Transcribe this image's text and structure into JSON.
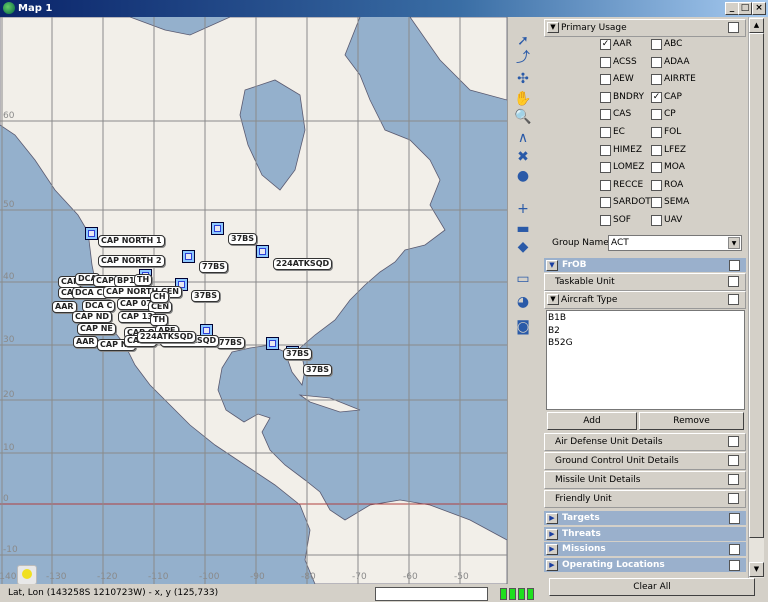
{
  "window": {
    "title": "Map 1",
    "controls": [
      "_",
      "□",
      "×"
    ]
  },
  "map": {
    "lat_labels": [
      "60",
      "50",
      "40",
      "30",
      "20",
      "10",
      "0",
      "-10"
    ],
    "lon_labels": [
      "-140",
      "-130",
      "-120",
      "-110",
      "-100",
      "-90",
      "-80",
      "-70",
      "-60",
      "-50"
    ],
    "colors": {
      "land": "#f2efe9",
      "water": "#94b0cc",
      "equator": "#b04040"
    },
    "labels": [
      "CAP NORTH 1",
      "CAP NORTH 2",
      "37BS",
      "224ATKSQD",
      "77BS",
      "37BS",
      "77BS",
      "37BS",
      "37BS",
      "224ATKSQD",
      "CAP",
      "DCA",
      "CAP G",
      "BP1",
      "TH",
      "CAP",
      "DCA CA",
      "CAP NORTH CEN",
      "AAR",
      "DCA C",
      "CAP 07",
      "CEN",
      "CAP ND",
      "CAP 13",
      "CH",
      "TH",
      "CAP NE",
      "CAP O",
      "APE",
      "AAR",
      "CAP NF",
      "CAP R",
      "224ATKSQD"
    ]
  },
  "toolbar": [
    "select-arrow",
    "select-route",
    "compass",
    "pan-hand",
    "zoom",
    "measure",
    "delete",
    "highlight",
    "add-point",
    "add-line",
    "add-area",
    "tag",
    "globe-back",
    "globe-lock"
  ],
  "panel": {
    "primary_usage": {
      "title": "Primary Usage",
      "checked": false,
      "items": [
        {
          "label": "AAR",
          "checked": true
        },
        {
          "label": "ABC",
          "checked": false
        },
        {
          "label": "ACSS",
          "checked": false
        },
        {
          "label": "ADAA",
          "checked": false
        },
        {
          "label": "AEW",
          "checked": false
        },
        {
          "label": "AIRRTE",
          "checked": false
        },
        {
          "label": "BNDRY",
          "checked": false
        },
        {
          "label": "CAP",
          "checked": true
        },
        {
          "label": "CAS",
          "checked": false
        },
        {
          "label": "CP",
          "checked": false
        },
        {
          "label": "EC",
          "checked": false
        },
        {
          "label": "FOL",
          "checked": false
        },
        {
          "label": "HIMEZ",
          "checked": false
        },
        {
          "label": "LFEZ",
          "checked": false
        },
        {
          "label": "LOMEZ",
          "checked": false
        },
        {
          "label": "MOA",
          "checked": false
        },
        {
          "label": "RECCE",
          "checked": false
        },
        {
          "label": "ROA",
          "checked": false
        },
        {
          "label": "SARDOT",
          "checked": false
        },
        {
          "label": "SEMA",
          "checked": false
        },
        {
          "label": "SOF",
          "checked": false
        },
        {
          "label": "UAV",
          "checked": false
        }
      ]
    },
    "group_name": {
      "label": "Group Name:",
      "value": "ACT"
    },
    "frob": {
      "title": "FrOB",
      "taskable_unit": "Taskable Unit",
      "aircraft_type": "Aircraft Type",
      "aircraft_list": [
        "B1B",
        "B2",
        "B52G"
      ],
      "add": "Add",
      "remove": "Remove",
      "details": [
        "Air Defense Unit Details",
        "Ground Control Unit Details",
        "Missile Unit Details",
        "Friendly Unit"
      ]
    },
    "sections": [
      "Targets",
      "Threats",
      "Missions",
      "Operating Locations"
    ],
    "clear_all": "Clear All"
  },
  "status": {
    "text": "Lat, Lon (143258S 1210723W) - x, y (125,733)",
    "input_value": "",
    "indicator_color": "#1ee01e"
  }
}
